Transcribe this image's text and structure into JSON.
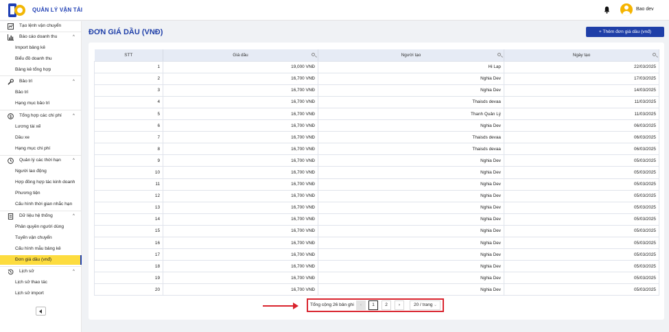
{
  "header": {
    "app_title": "QUẢN LÝ VẬN TẢI",
    "user_name": "Bao dev",
    "icons": {
      "notification": "bell-icon",
      "avatar": "user-avatar-icon"
    }
  },
  "sidebar": {
    "items": [
      {
        "type": "item",
        "label": "Tạo lệnh vận chuyển",
        "icon": "chart-icon",
        "chevron": ""
      },
      {
        "type": "item",
        "label": "Báo cáo doanh thu",
        "icon": "bar-chart-icon",
        "chevron": "^"
      },
      {
        "type": "sub",
        "label": "Import bảng kê"
      },
      {
        "type": "sub",
        "label": "Biểu đồ doanh thu"
      },
      {
        "type": "sub",
        "label": "Bảng kê tổng hợp"
      },
      {
        "type": "item",
        "label": "Bảo trì",
        "icon": "wrench-icon",
        "chevron": "^"
      },
      {
        "type": "sub",
        "label": "Bảo trì"
      },
      {
        "type": "sub",
        "label": "Hạng mục bảo trì"
      },
      {
        "type": "item",
        "label": "Tổng hợp các chi phí",
        "icon": "dollar-icon",
        "chevron": "^"
      },
      {
        "type": "sub",
        "label": "Lương tài xế"
      },
      {
        "type": "sub",
        "label": "Dầu xe"
      },
      {
        "type": "sub",
        "label": "Hạng mục chi phí"
      },
      {
        "type": "item",
        "label": "Quản lý các thời hạn",
        "icon": "clock-icon",
        "chevron": "^"
      },
      {
        "type": "sub",
        "label": "Người lao động"
      },
      {
        "type": "sub",
        "label": "Hợp đồng hợp tác kinh doanh"
      },
      {
        "type": "sub",
        "label": "Phương tiện"
      },
      {
        "type": "sub",
        "label": "Cấu hình thời gian nhắc hạn"
      },
      {
        "type": "item",
        "label": "Dữ liệu hệ thống",
        "icon": "database-icon",
        "chevron": "^"
      },
      {
        "type": "sub",
        "label": "Phân quyền người dùng"
      },
      {
        "type": "sub",
        "label": "Tuyến vận chuyển"
      },
      {
        "type": "sub",
        "label": "Cấu hình mẫu bảng kê"
      },
      {
        "type": "sub",
        "label": "Đơn giá dầu (vnđ)",
        "active": true
      },
      {
        "type": "item",
        "label": "Lịch sử",
        "icon": "history-icon",
        "chevron": "^"
      },
      {
        "type": "sub",
        "label": "Lịch sử thao tác"
      },
      {
        "type": "sub",
        "label": "Lịch sử import"
      }
    ]
  },
  "main": {
    "page_title": "ĐƠN GIÁ DẦU (VNĐ)",
    "add_button": "+ Thêm đơn giá dầu (vnđ)",
    "table": {
      "columns": [
        "STT",
        "Giá dầu",
        "Người tạo",
        "Ngày tạo"
      ],
      "rows": [
        [
          "1",
          "19,000 VNĐ",
          "Hi Lap",
          "22/03/2025"
        ],
        [
          "2",
          "16,700 VNĐ",
          "Nghia Dev",
          "17/03/2025"
        ],
        [
          "3",
          "16,700 VNĐ",
          "Nghia Dev",
          "14/03/2025"
        ],
        [
          "4",
          "16,700 VNĐ",
          "Thaisds devaa",
          "11/03/2025"
        ],
        [
          "5",
          "16,700 VNĐ",
          "Thanh Quản Lý",
          "11/03/2025"
        ],
        [
          "6",
          "16,700 VNĐ",
          "Nghia Dev",
          "06/03/2025"
        ],
        [
          "7",
          "16,700 VNĐ",
          "Thaisds devaa",
          "06/03/2025"
        ],
        [
          "8",
          "16,700 VNĐ",
          "Thaisds devaa",
          "06/03/2025"
        ],
        [
          "9",
          "16,700 VNĐ",
          "Nghia Dev",
          "05/03/2025"
        ],
        [
          "10",
          "16,700 VNĐ",
          "Nghia Dev",
          "05/03/2025"
        ],
        [
          "11",
          "16,700 VNĐ",
          "Nghia Dev",
          "05/03/2025"
        ],
        [
          "12",
          "16,700 VNĐ",
          "Nghia Dev",
          "05/03/2025"
        ],
        [
          "13",
          "16,700 VNĐ",
          "Nghia Dev",
          "05/03/2025"
        ],
        [
          "14",
          "16,700 VNĐ",
          "Nghia Dev",
          "05/03/2025"
        ],
        [
          "15",
          "16,700 VNĐ",
          "Nghia Dev",
          "05/03/2025"
        ],
        [
          "16",
          "16,700 VNĐ",
          "Nghia Dev",
          "05/03/2025"
        ],
        [
          "17",
          "16,700 VNĐ",
          "Nghia Dev",
          "05/03/2025"
        ],
        [
          "18",
          "16,700 VNĐ",
          "Nghia Dev",
          "05/03/2025"
        ],
        [
          "19",
          "16,700 VNĐ",
          "Nghia Dev",
          "05/03/2025"
        ],
        [
          "20",
          "16,700 VNĐ",
          "Nghia Dev",
          "05/03/2025"
        ]
      ]
    },
    "pagination": {
      "total_text": "Tổng cộng 26 bản ghi",
      "prev": "‹",
      "pages": [
        "1",
        "2"
      ],
      "next": "›",
      "page_size": "20 / trang",
      "current_page": "1"
    }
  },
  "colors": {
    "brand": "#1f3fa8",
    "active_menu": "#fddc3f",
    "highlight": "#d9232d"
  }
}
